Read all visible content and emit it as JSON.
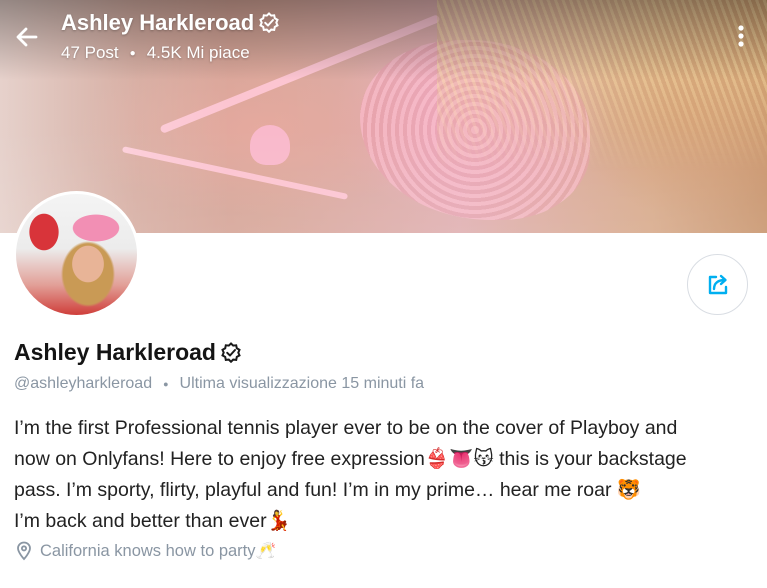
{
  "header": {
    "name": "Ashley Harkleroad",
    "posts": "47 Post",
    "likes": "4.5K Mi piace",
    "back_icon": "arrow-left-icon",
    "menu_icon": "more-vertical-icon"
  },
  "profile": {
    "name": "Ashley Harkleroad",
    "username": "@ashleyharkleroad",
    "last_seen": "Ultima visualizzazione 15 minuti fa",
    "verified_icon": "verified-badge-icon",
    "share_icon": "share-icon"
  },
  "bio": {
    "line1": "I’m the first Professional tennis player ever to be on the cover of Playboy and",
    "line2": "now on Onlyfans! Here to enjoy free expression👙👅😽 this is your backstage",
    "line3": "pass. I’m sporty, flirty, playful and fun! I’m in my prime… hear me roar 🐯",
    "line4": "I’m back and better than ever💃"
  },
  "location": {
    "text": "California knows how to party🥂",
    "icon": "location-pin-icon"
  },
  "colors": {
    "accent": "#00aff0",
    "muted": "#8a96a3",
    "text": "#141414"
  }
}
